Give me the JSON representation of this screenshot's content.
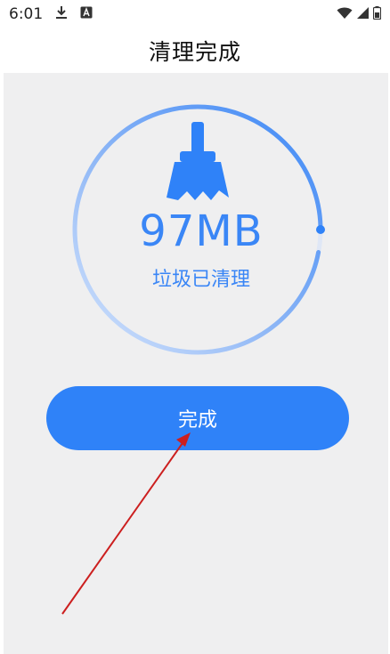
{
  "status_bar": {
    "time": "6:01",
    "icons": [
      "download-icon",
      "notification-a-icon",
      "wifi-icon",
      "signal-icon",
      "battery-icon"
    ]
  },
  "header": {
    "title": "清理完成"
  },
  "result": {
    "amount": "97MB",
    "caption": "垃圾已清理",
    "progress": 0.97
  },
  "actions": {
    "done_label": "完成"
  },
  "colors": {
    "accent": "#2f82f8",
    "accent_light": "#c9dcfb",
    "background": "#efeff0",
    "annotation_arrow": "#cc1f1f"
  }
}
